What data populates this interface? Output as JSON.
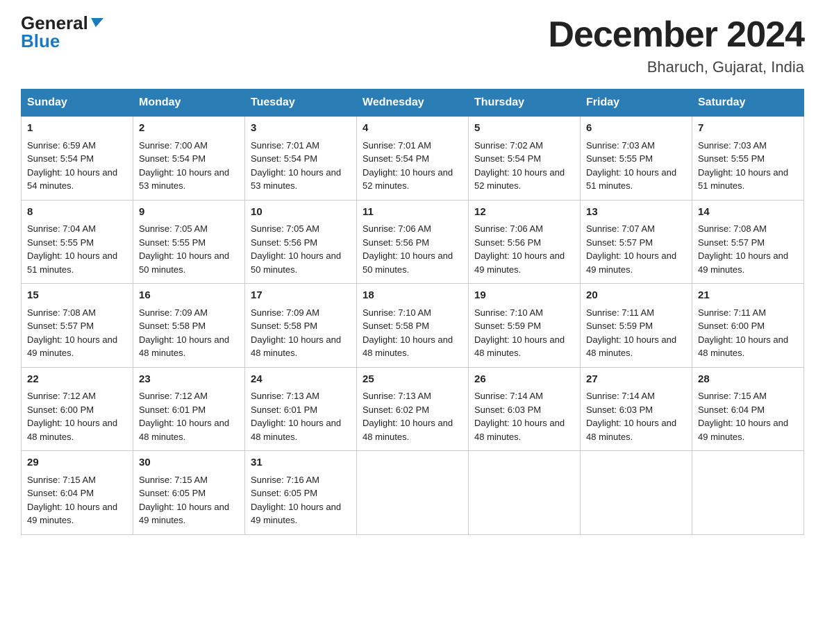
{
  "header": {
    "logo_general": "General",
    "logo_blue": "Blue",
    "month_title": "December 2024",
    "location": "Bharuch, Gujarat, India"
  },
  "weekdays": [
    "Sunday",
    "Monday",
    "Tuesday",
    "Wednesday",
    "Thursday",
    "Friday",
    "Saturday"
  ],
  "weeks": [
    [
      {
        "day": "1",
        "sunrise": "6:59 AM",
        "sunset": "5:54 PM",
        "daylight": "10 hours and 54 minutes."
      },
      {
        "day": "2",
        "sunrise": "7:00 AM",
        "sunset": "5:54 PM",
        "daylight": "10 hours and 53 minutes."
      },
      {
        "day": "3",
        "sunrise": "7:01 AM",
        "sunset": "5:54 PM",
        "daylight": "10 hours and 53 minutes."
      },
      {
        "day": "4",
        "sunrise": "7:01 AM",
        "sunset": "5:54 PM",
        "daylight": "10 hours and 52 minutes."
      },
      {
        "day": "5",
        "sunrise": "7:02 AM",
        "sunset": "5:54 PM",
        "daylight": "10 hours and 52 minutes."
      },
      {
        "day": "6",
        "sunrise": "7:03 AM",
        "sunset": "5:55 PM",
        "daylight": "10 hours and 51 minutes."
      },
      {
        "day": "7",
        "sunrise": "7:03 AM",
        "sunset": "5:55 PM",
        "daylight": "10 hours and 51 minutes."
      }
    ],
    [
      {
        "day": "8",
        "sunrise": "7:04 AM",
        "sunset": "5:55 PM",
        "daylight": "10 hours and 51 minutes."
      },
      {
        "day": "9",
        "sunrise": "7:05 AM",
        "sunset": "5:55 PM",
        "daylight": "10 hours and 50 minutes."
      },
      {
        "day": "10",
        "sunrise": "7:05 AM",
        "sunset": "5:56 PM",
        "daylight": "10 hours and 50 minutes."
      },
      {
        "day": "11",
        "sunrise": "7:06 AM",
        "sunset": "5:56 PM",
        "daylight": "10 hours and 50 minutes."
      },
      {
        "day": "12",
        "sunrise": "7:06 AM",
        "sunset": "5:56 PM",
        "daylight": "10 hours and 49 minutes."
      },
      {
        "day": "13",
        "sunrise": "7:07 AM",
        "sunset": "5:57 PM",
        "daylight": "10 hours and 49 minutes."
      },
      {
        "day": "14",
        "sunrise": "7:08 AM",
        "sunset": "5:57 PM",
        "daylight": "10 hours and 49 minutes."
      }
    ],
    [
      {
        "day": "15",
        "sunrise": "7:08 AM",
        "sunset": "5:57 PM",
        "daylight": "10 hours and 49 minutes."
      },
      {
        "day": "16",
        "sunrise": "7:09 AM",
        "sunset": "5:58 PM",
        "daylight": "10 hours and 48 minutes."
      },
      {
        "day": "17",
        "sunrise": "7:09 AM",
        "sunset": "5:58 PM",
        "daylight": "10 hours and 48 minutes."
      },
      {
        "day": "18",
        "sunrise": "7:10 AM",
        "sunset": "5:58 PM",
        "daylight": "10 hours and 48 minutes."
      },
      {
        "day": "19",
        "sunrise": "7:10 AM",
        "sunset": "5:59 PM",
        "daylight": "10 hours and 48 minutes."
      },
      {
        "day": "20",
        "sunrise": "7:11 AM",
        "sunset": "5:59 PM",
        "daylight": "10 hours and 48 minutes."
      },
      {
        "day": "21",
        "sunrise": "7:11 AM",
        "sunset": "6:00 PM",
        "daylight": "10 hours and 48 minutes."
      }
    ],
    [
      {
        "day": "22",
        "sunrise": "7:12 AM",
        "sunset": "6:00 PM",
        "daylight": "10 hours and 48 minutes."
      },
      {
        "day": "23",
        "sunrise": "7:12 AM",
        "sunset": "6:01 PM",
        "daylight": "10 hours and 48 minutes."
      },
      {
        "day": "24",
        "sunrise": "7:13 AM",
        "sunset": "6:01 PM",
        "daylight": "10 hours and 48 minutes."
      },
      {
        "day": "25",
        "sunrise": "7:13 AM",
        "sunset": "6:02 PM",
        "daylight": "10 hours and 48 minutes."
      },
      {
        "day": "26",
        "sunrise": "7:14 AM",
        "sunset": "6:03 PM",
        "daylight": "10 hours and 48 minutes."
      },
      {
        "day": "27",
        "sunrise": "7:14 AM",
        "sunset": "6:03 PM",
        "daylight": "10 hours and 48 minutes."
      },
      {
        "day": "28",
        "sunrise": "7:15 AM",
        "sunset": "6:04 PM",
        "daylight": "10 hours and 49 minutes."
      }
    ],
    [
      {
        "day": "29",
        "sunrise": "7:15 AM",
        "sunset": "6:04 PM",
        "daylight": "10 hours and 49 minutes."
      },
      {
        "day": "30",
        "sunrise": "7:15 AM",
        "sunset": "6:05 PM",
        "daylight": "10 hours and 49 minutes."
      },
      {
        "day": "31",
        "sunrise": "7:16 AM",
        "sunset": "6:05 PM",
        "daylight": "10 hours and 49 minutes."
      },
      null,
      null,
      null,
      null
    ]
  ],
  "labels": {
    "sunrise": "Sunrise: ",
    "sunset": "Sunset: ",
    "daylight": "Daylight: "
  }
}
